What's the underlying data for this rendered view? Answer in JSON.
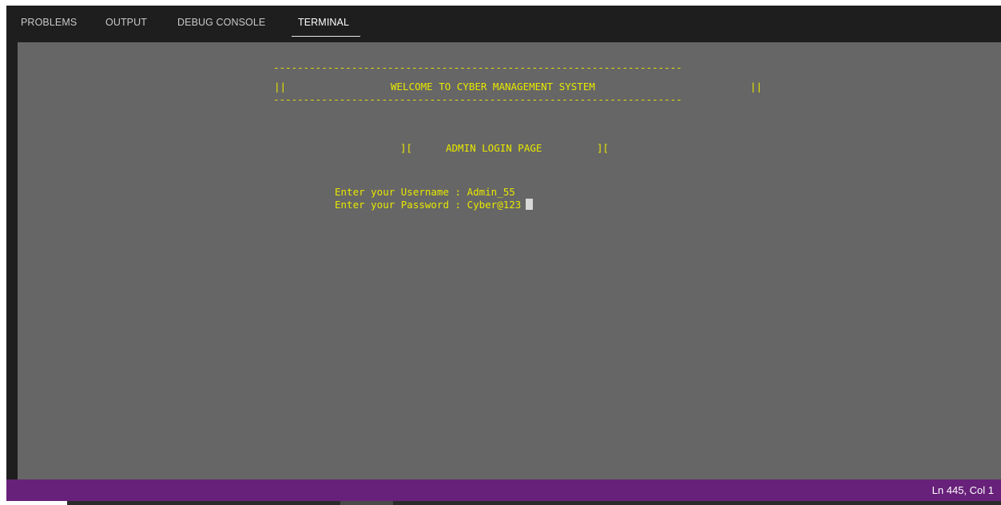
{
  "tabs": [
    {
      "label": "PROBLEMS",
      "active": false
    },
    {
      "label": "OUTPUT",
      "active": false
    },
    {
      "label": "DEBUG CONSOLE",
      "active": false
    },
    {
      "label": "TERMINAL",
      "active": true
    }
  ],
  "terminal": {
    "separator_top": "--------------------------------------------------------------------",
    "welcome_left": "||",
    "welcome_text": "WELCOME TO CYBER MANAGEMENT SYSTEM",
    "welcome_right": "||",
    "separator_bottom": "--------------------------------------------------------------------",
    "admin_left": "][",
    "admin_text": "ADMIN LOGIN PAGE",
    "admin_right": "][",
    "username_prompt": "Enter your Username : ",
    "username_value": "Admin_55",
    "password_prompt": "Enter your Password : ",
    "password_value": "Cyber@123"
  },
  "status_bar": {
    "position": "Ln 445, Col 1"
  },
  "colors": {
    "terminal_bg": "#666666",
    "terminal_text": "#e8e800",
    "status_bar": "#68217a",
    "panel_bg": "#1e1e1e"
  }
}
